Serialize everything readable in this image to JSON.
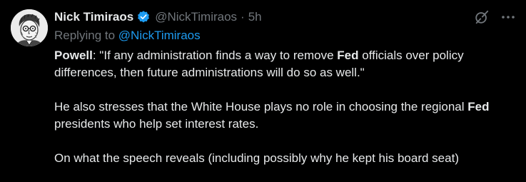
{
  "tweet": {
    "author": {
      "name": "Nick Timiraos",
      "handle": "@NickTimiraos",
      "time": "5h",
      "separator": "·"
    },
    "reply": {
      "prefix": "Replying to ",
      "mention": "@NickTimiraos"
    },
    "paragraph1": {
      "bold1": "Powell",
      "text1": ": \"If any administration finds a way to remove ",
      "bold2": "Fed",
      "text2": " officials over policy differences, then future administrations will do so as well.\""
    },
    "paragraph2": {
      "text1": "He also stresses that the White House plays no role in choosing the regional ",
      "bold1": "Fed",
      "text2": " presidents who help set interest rates."
    },
    "paragraph3": {
      "text1": "On what the speech reveals (including possibly why he kept his board seat)"
    },
    "icons": {
      "verified": "verified-badge-icon",
      "grok": "grok-icon",
      "more": "more-icon"
    },
    "colors": {
      "background": "#000000",
      "text": "#e7e9ea",
      "muted": "#71767b",
      "accent": "#1d9bf0"
    }
  }
}
